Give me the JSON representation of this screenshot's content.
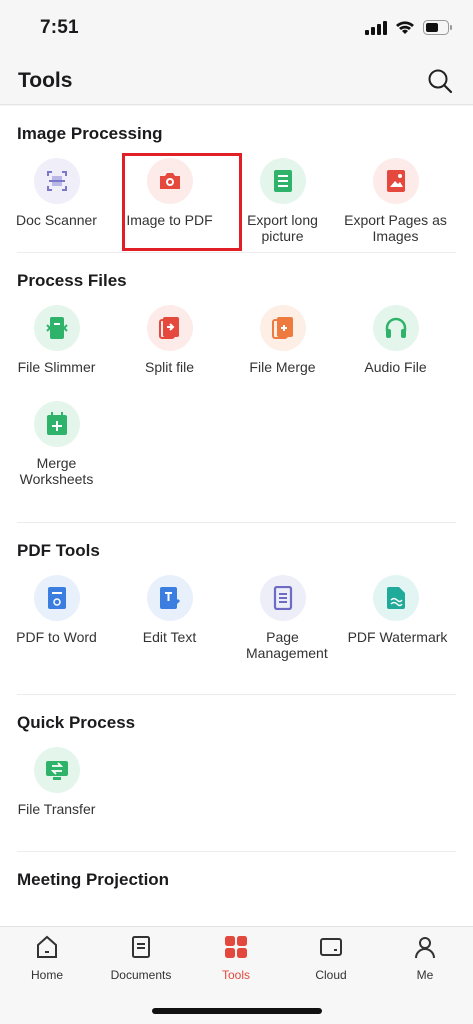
{
  "status": {
    "time": "7:51"
  },
  "header": {
    "title": "Tools"
  },
  "sections": [
    {
      "title": "Image Processing",
      "tools": [
        "Doc Scanner",
        "Image to PDF",
        "Export long picture",
        "Export Pages as Images"
      ]
    },
    {
      "title": "Process Files",
      "tools": [
        "File Slimmer",
        "Split file",
        "File Merge",
        "Audio File",
        "Merge Worksheets"
      ]
    },
    {
      "title": "PDF Tools",
      "tools": [
        "PDF to Word",
        "Edit Text",
        "Page Management",
        "PDF Watermark"
      ]
    },
    {
      "title": "Quick Process",
      "tools": [
        "File Transfer"
      ]
    },
    {
      "title": "Meeting Projection",
      "tools": []
    }
  ],
  "tabs": [
    "Home",
    "Documents",
    "Tools",
    "Cloud",
    "Me"
  ],
  "active_tab": "Tools",
  "colors": {
    "accent": "#e2493c",
    "highlight_box": "#e21f26"
  }
}
